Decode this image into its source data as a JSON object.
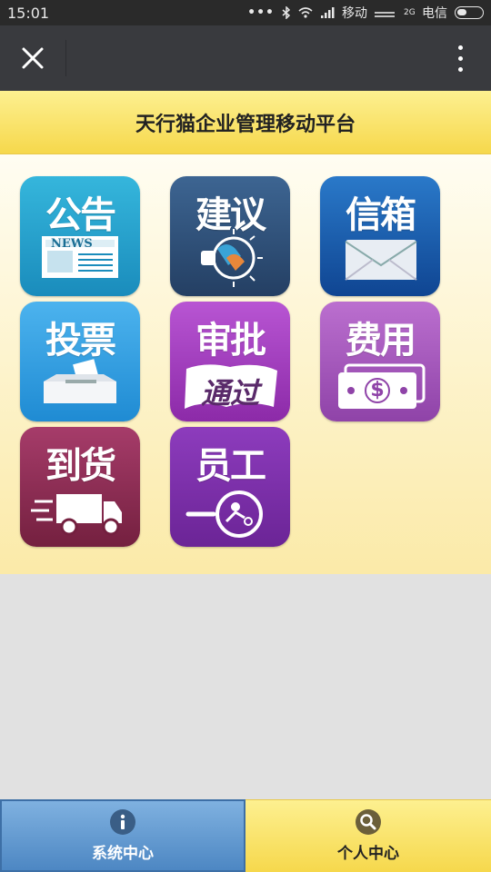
{
  "status_bar": {
    "time": "15:01",
    "carrier1": "移动",
    "carrier2": "电信",
    "net_type": "2G"
  },
  "actionbar": {
    "close_icon": "close-icon",
    "more_icon": "more-vertical-icon"
  },
  "header": {
    "title": "天行猫企业管理移动平台"
  },
  "tiles": [
    {
      "label": "公告",
      "sub": "NEWS",
      "icon": "newspaper-icon",
      "color": "#1d9bc8"
    },
    {
      "label": "建议",
      "icon": "lightbulb-icon",
      "color": "#2d4f79"
    },
    {
      "label": "信箱",
      "icon": "envelope-icon",
      "color": "#1656a8"
    },
    {
      "label": "投票",
      "icon": "ballot-box-icon",
      "color": "#2f9bdd"
    },
    {
      "label": "审批",
      "sub": "通过",
      "icon": "approval-stamp-icon",
      "color": "#a73fc0"
    },
    {
      "label": "费用",
      "sub": "$",
      "icon": "banknote-icon",
      "color": "#a553b8"
    },
    {
      "label": "到货",
      "icon": "truck-icon",
      "color": "#8e2d55"
    },
    {
      "label": "员工",
      "icon": "staff-search-icon",
      "color": "#7a2fa6"
    }
  ],
  "bottom_nav": {
    "system_center": "系统中心",
    "personal_center": "个人中心",
    "system_icon": "info-icon",
    "personal_icon": "search-icon"
  }
}
